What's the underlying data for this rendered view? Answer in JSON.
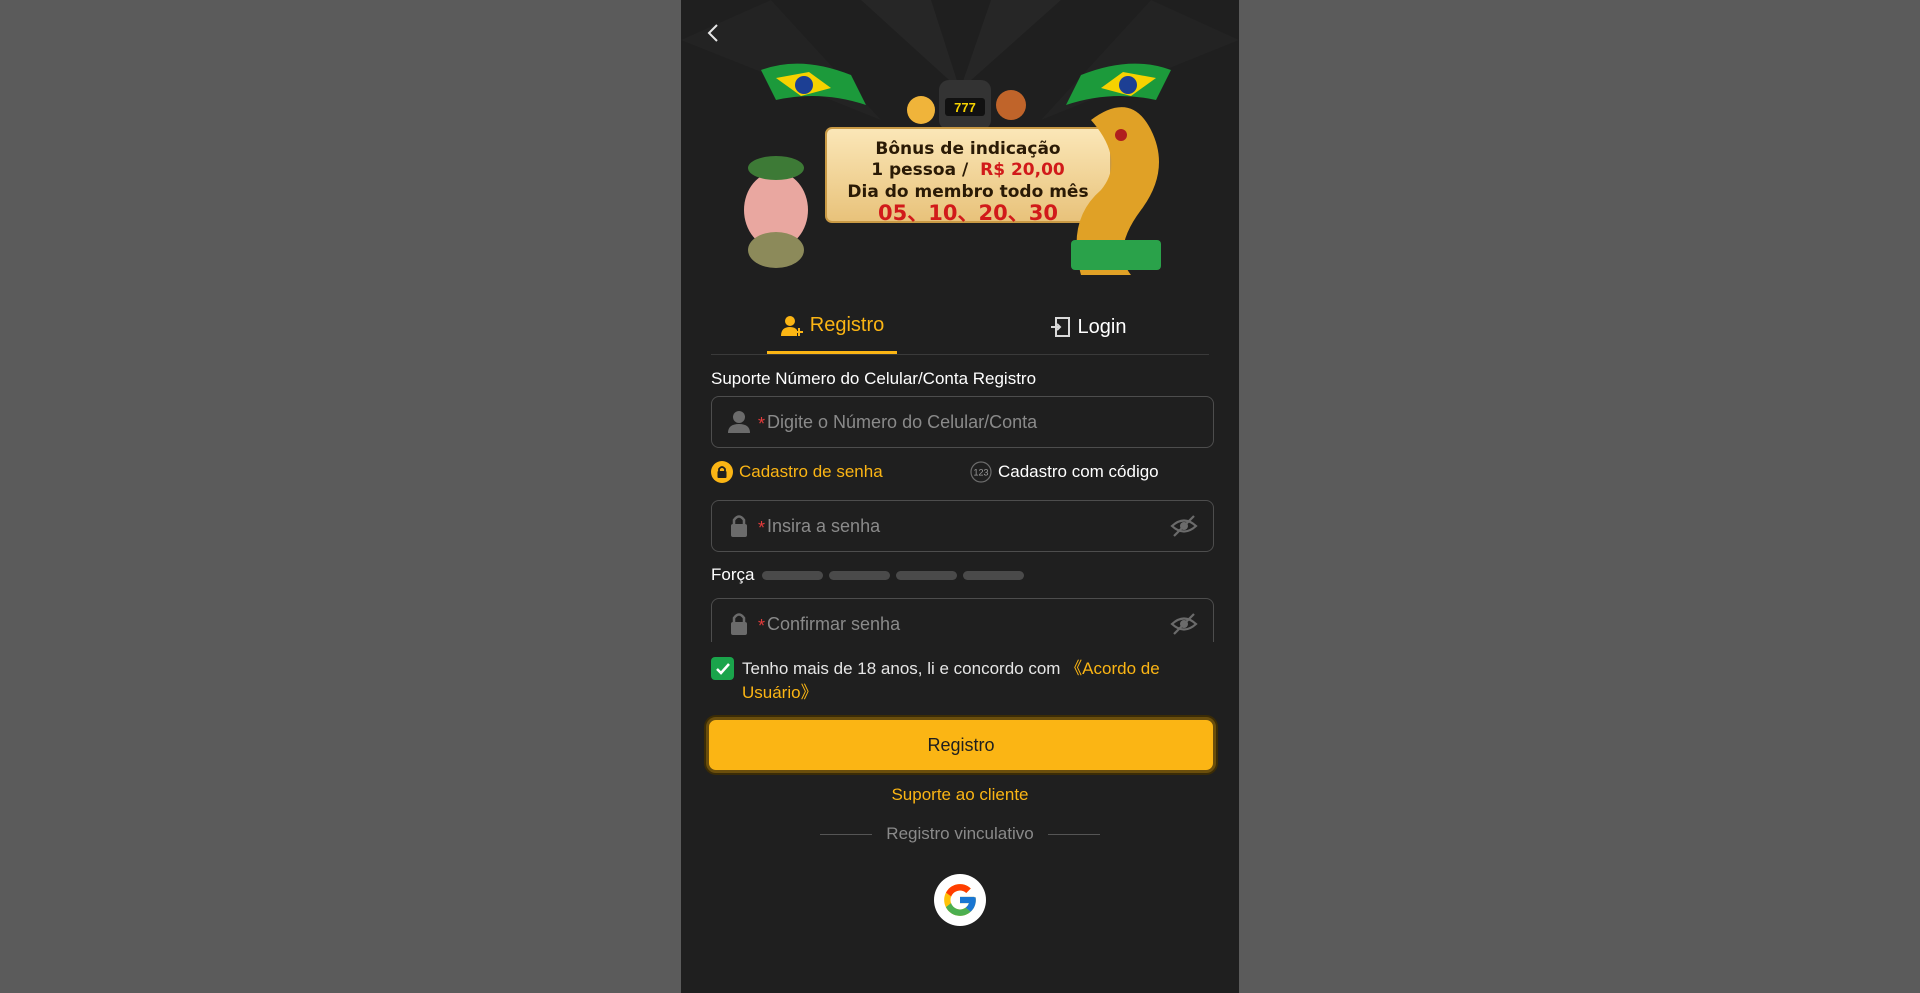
{
  "banner": {
    "line1": "Bônus de indicação",
    "line2_prefix": "1 pessoa /",
    "line2_amount": "R$ 20,00",
    "line3": "Dia do membro todo mês",
    "line4": "05、10、20、30"
  },
  "tabs": {
    "register": "Registro",
    "login": "Login"
  },
  "form": {
    "account_label": "Suporte Número do Celular/Conta Registro",
    "account_placeholder": "Digite o Número do Celular/Conta",
    "required_mark": "*",
    "mode_password": "Cadastro de senha",
    "mode_code": "Cadastro com código",
    "mode_code_badge": "123",
    "password_placeholder": "Insira a senha",
    "strength_label": "Força",
    "confirm_placeholder": "Confirmar senha",
    "agree_text": "Tenho mais de 18 anos, li e concordo com ",
    "agree_link": "《Acordo de Usuário》",
    "agree_checked": true,
    "submit": "Registro"
  },
  "support": "Suporte ao cliente",
  "social": {
    "divider": "Registro vinculativo",
    "providers": [
      "google-icon"
    ]
  },
  "colors": {
    "accent": "#fbb514",
    "background": "#1f1f1f",
    "overlay": "#5b5b5b",
    "check": "#1aa44b",
    "required": "#e33b3b"
  }
}
